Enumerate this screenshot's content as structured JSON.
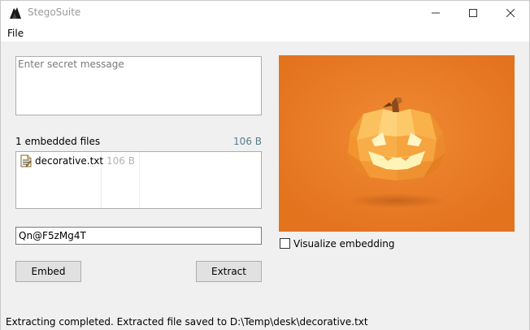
{
  "window": {
    "title": "StegoSuite"
  },
  "menu": {
    "file": "File"
  },
  "secret": {
    "placeholder": "Enter secret message",
    "value": ""
  },
  "files": {
    "count_label": "1 embedded files",
    "total_size": "106 B",
    "items": [
      {
        "name": "decorative.txt",
        "size": "106 B",
        "icon": "text-file-icon"
      }
    ]
  },
  "password": {
    "value": "Qn@F5zMg4T"
  },
  "buttons": {
    "embed": "Embed",
    "extract": "Extract"
  },
  "preview": {
    "subject": "low-poly jack-o'-lantern pumpkin",
    "background_color": "#e87722"
  },
  "visualize": {
    "label": "Visualize embedding",
    "checked": false
  },
  "status": {
    "text": "Extracting completed. Extracted file saved to D:\\Temp\\desk\\decorative.txt"
  }
}
